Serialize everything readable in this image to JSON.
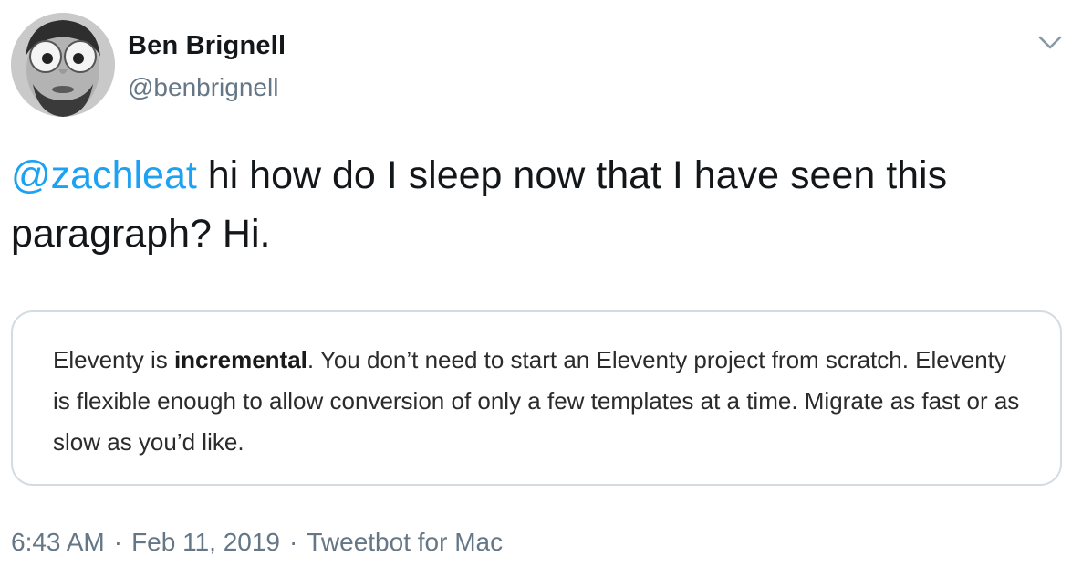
{
  "author": {
    "name": "Ben Brignell",
    "handle": "@benbrignell"
  },
  "tweet": {
    "mention": "@zachleat",
    "text": " hi how do I sleep now that I have seen this paragraph? Hi."
  },
  "quote": {
    "part1": "Eleventy is ",
    "bold": "incremental",
    "part2": ". You don’t need to start an Eleventy project from scratch. Eleventy is flexible enough to allow conversion of only a few templates at a time. Migrate as fast or as slow as you’d like."
  },
  "meta": {
    "time": "6:43 AM",
    "separator": "·",
    "date": "Feb 11, 2019",
    "source": "Tweetbot for Mac"
  },
  "icons": {
    "menu": "chevron-down-icon"
  },
  "colors": {
    "mention": "#1da1f2",
    "secondary_text": "#657786",
    "card_border": "#d5dce1"
  }
}
